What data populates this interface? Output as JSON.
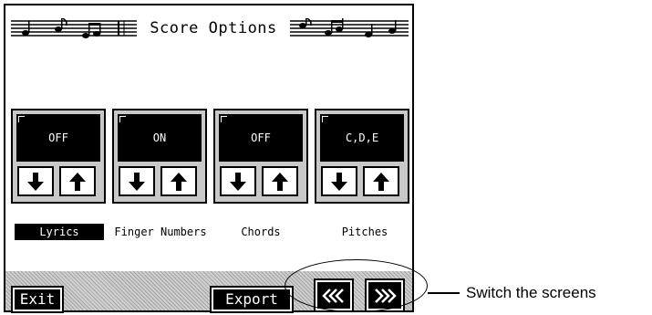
{
  "screen": {
    "title": "Score Options"
  },
  "controls": [
    {
      "value": "OFF",
      "label": "Lyrics",
      "selected": true
    },
    {
      "value": "ON",
      "label": "Finger Numbers",
      "selected": false
    },
    {
      "value": "OFF",
      "label": "Chords",
      "selected": false
    },
    {
      "value": "C,D,E",
      "label": "Pitches",
      "selected": false
    }
  ],
  "bottom_bar": {
    "exit_label": "Exit",
    "export_label": "Export",
    "prev_icon": "double-chevron-left-icon",
    "next_icon": "double-chevron-right-icon"
  },
  "callout": {
    "text": "Switch the screens"
  }
}
